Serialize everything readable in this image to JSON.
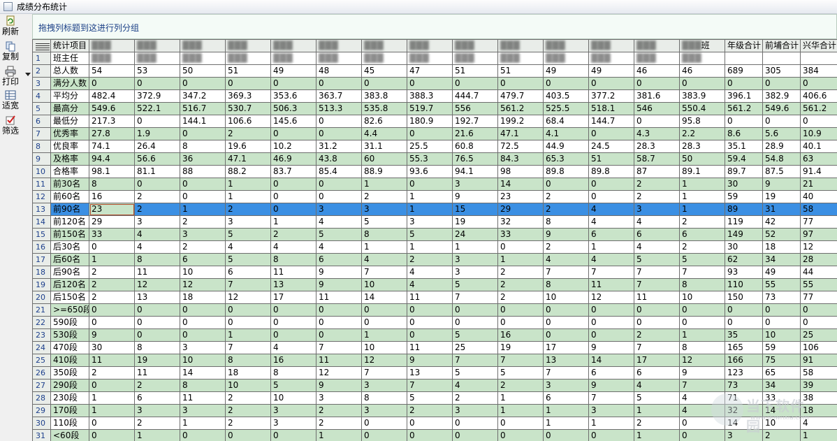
{
  "window": {
    "title": "成绩分布统计"
  },
  "toolbar": {
    "refresh": "刷新",
    "copy": "复制",
    "print": "打印",
    "fit_width": "适宽",
    "filter": "筛选"
  },
  "group_panel": {
    "hint": "拖拽列标题到这进行列分组"
  },
  "grid": {
    "header_item": "统计项目",
    "header_partial": "班",
    "header_totals": [
      "年级合计",
      "前埔合计",
      "兴华合计"
    ],
    "row1": {
      "label": "班主任",
      "placeholder": "▓▓▓"
    },
    "rows": [
      {
        "n": "2",
        "label": "总人数",
        "vals": [
          "54",
          "53",
          "50",
          "51",
          "49",
          "48",
          "45",
          "47",
          "51",
          "51",
          "49",
          "49",
          "46",
          "46",
          "689",
          "305",
          "384"
        ]
      },
      {
        "n": "3",
        "label": "满分人数",
        "vals": [
          "0",
          "0",
          "0",
          "0",
          "0",
          "0",
          "0",
          "0",
          "0",
          "0",
          "0",
          "0",
          "0",
          "0",
          "0",
          "0",
          "0"
        ]
      },
      {
        "n": "4",
        "label": "平均分",
        "vals": [
          "482.4",
          "372.9",
          "347.2",
          "369.3",
          "353.6",
          "363.7",
          "383.8",
          "388.3",
          "444.7",
          "479.7",
          "403.5",
          "377.2",
          "381.6",
          "383.9",
          "396.1",
          "382.9",
          "406.6"
        ]
      },
      {
        "n": "5",
        "label": "最高分",
        "vals": [
          "549.6",
          "522.1",
          "516.7",
          "530.7",
          "506.3",
          "513.3",
          "535.8",
          "519.7",
          "556",
          "561.2",
          "525.5",
          "518.1",
          "546",
          "550.4",
          "561.2",
          "549.6",
          "561.2"
        ]
      },
      {
        "n": "6",
        "label": "最低分",
        "vals": [
          "217.3",
          "0",
          "144.1",
          "106.6",
          "145.6",
          "0",
          "82.6",
          "180.9",
          "192.7",
          "199.2",
          "68.4",
          "144.7",
          "0",
          "95.8",
          "0",
          "0",
          "0"
        ]
      },
      {
        "n": "7",
        "label": "优秀率",
        "vals": [
          "27.8",
          "1.9",
          "0",
          "2",
          "0",
          "0",
          "4.4",
          "0",
          "21.6",
          "47.1",
          "4.1",
          "0",
          "4.3",
          "2.2",
          "8.6",
          "5.6",
          "10.9"
        ]
      },
      {
        "n": "8",
        "label": "优良率",
        "vals": [
          "74.1",
          "26.4",
          "8",
          "19.6",
          "10.2",
          "31.2",
          "31.1",
          "25.5",
          "60.8",
          "72.5",
          "44.9",
          "24.5",
          "28.3",
          "28.3",
          "35.1",
          "28.9",
          "40.1"
        ]
      },
      {
        "n": "9",
        "label": "及格率",
        "vals": [
          "94.4",
          "56.6",
          "36",
          "47.1",
          "46.9",
          "43.8",
          "60",
          "55.3",
          "76.5",
          "84.3",
          "65.3",
          "51",
          "58.7",
          "50",
          "59.4",
          "54.8",
          "63"
        ]
      },
      {
        "n": "10",
        "label": "合格率",
        "vals": [
          "98.1",
          "81.1",
          "88",
          "88.2",
          "83.7",
          "85.4",
          "88.9",
          "93.6",
          "94.1",
          "98",
          "89.8",
          "89.8",
          "87",
          "89.1",
          "89.7",
          "87.5",
          "91.4"
        ]
      },
      {
        "n": "11",
        "label": "前30名",
        "vals": [
          "8",
          "0",
          "0",
          "1",
          "0",
          "0",
          "1",
          "0",
          "3",
          "14",
          "0",
          "0",
          "2",
          "1",
          "30",
          "9",
          "21"
        ]
      },
      {
        "n": "12",
        "label": "前60名",
        "vals": [
          "16",
          "2",
          "0",
          "1",
          "0",
          "0",
          "2",
          "1",
          "9",
          "23",
          "2",
          "0",
          "2",
          "1",
          "59",
          "19",
          "40"
        ]
      },
      {
        "n": "13",
        "label": "前90名",
        "vals": [
          "23",
          "2",
          "1",
          "2",
          "0",
          "3",
          "3",
          "1",
          "15",
          "29",
          "2",
          "4",
          "3",
          "1",
          "89",
          "31",
          "58"
        ]
      },
      {
        "n": "14",
        "label": "前120名",
        "vals": [
          "29",
          "3",
          "2",
          "3",
          "1",
          "4",
          "5",
          "3",
          "19",
          "32",
          "8",
          "4",
          "4",
          "2",
          "119",
          "42",
          "77"
        ]
      },
      {
        "n": "15",
        "label": "前150名",
        "vals": [
          "33",
          "4",
          "3",
          "5",
          "2",
          "5",
          "8",
          "5",
          "24",
          "33",
          "9",
          "6",
          "6",
          "6",
          "149",
          "52",
          "97"
        ]
      },
      {
        "n": "16",
        "label": "后30名",
        "vals": [
          "0",
          "4",
          "2",
          "4",
          "4",
          "4",
          "1",
          "1",
          "1",
          "0",
          "2",
          "1",
          "4",
          "2",
          "30",
          "18",
          "12"
        ]
      },
      {
        "n": "17",
        "label": "后60名",
        "vals": [
          "1",
          "8",
          "6",
          "5",
          "8",
          "6",
          "4",
          "2",
          "3",
          "1",
          "4",
          "4",
          "5",
          "5",
          "62",
          "34",
          "28"
        ]
      },
      {
        "n": "18",
        "label": "后90名",
        "vals": [
          "2",
          "11",
          "10",
          "6",
          "11",
          "9",
          "7",
          "4",
          "3",
          "2",
          "7",
          "7",
          "7",
          "7",
          "93",
          "49",
          "44"
        ]
      },
      {
        "n": "19",
        "label": "后120名",
        "vals": [
          "2",
          "12",
          "12",
          "7",
          "13",
          "9",
          "10",
          "4",
          "5",
          "2",
          "8",
          "11",
          "7",
          "8",
          "110",
          "55",
          "55"
        ]
      },
      {
        "n": "20",
        "label": "后150名",
        "vals": [
          "2",
          "13",
          "18",
          "12",
          "17",
          "11",
          "14",
          "11",
          "7",
          "2",
          "10",
          "12",
          "11",
          "10",
          "150",
          "73",
          "77"
        ]
      },
      {
        "n": "21",
        "label": ">=650段",
        "vals": [
          "0",
          "0",
          "0",
          "0",
          "0",
          "0",
          "0",
          "0",
          "0",
          "0",
          "0",
          "0",
          "0",
          "0",
          "0",
          "0",
          "0"
        ]
      },
      {
        "n": "22",
        "label": "590段",
        "vals": [
          "0",
          "0",
          "0",
          "0",
          "0",
          "0",
          "0",
          "0",
          "0",
          "0",
          "0",
          "0",
          "0",
          "0",
          "0",
          "0",
          "0"
        ]
      },
      {
        "n": "23",
        "label": "530段",
        "vals": [
          "9",
          "0",
          "0",
          "1",
          "0",
          "0",
          "1",
          "0",
          "5",
          "16",
          "0",
          "0",
          "2",
          "1",
          "35",
          "10",
          "25"
        ]
      },
      {
        "n": "24",
        "label": "470段",
        "vals": [
          "30",
          "8",
          "3",
          "7",
          "4",
          "7",
          "10",
          "11",
          "25",
          "19",
          "17",
          "9",
          "7",
          "8",
          "165",
          "59",
          "106"
        ]
      },
      {
        "n": "25",
        "label": "410段",
        "vals": [
          "11",
          "19",
          "10",
          "8",
          "16",
          "11",
          "12",
          "9",
          "7",
          "7",
          "13",
          "14",
          "17",
          "12",
          "166",
          "75",
          "91"
        ]
      },
      {
        "n": "26",
        "label": "350段",
        "vals": [
          "2",
          "11",
          "14",
          "18",
          "8",
          "12",
          "7",
          "13",
          "5",
          "5",
          "7",
          "6",
          "6",
          "9",
          "123",
          "65",
          "58"
        ]
      },
      {
        "n": "27",
        "label": "290段",
        "vals": [
          "0",
          "2",
          "8",
          "10",
          "5",
          "9",
          "3",
          "7",
          "4",
          "2",
          "3",
          "9",
          "4",
          "7",
          "73",
          "34",
          "39"
        ]
      },
      {
        "n": "28",
        "label": "230段",
        "vals": [
          "1",
          "6",
          "11",
          "2",
          "10",
          "3",
          "8",
          "5",
          "2",
          "1",
          "6",
          "7",
          "5",
          "4",
          "71",
          "33",
          "38"
        ]
      },
      {
        "n": "29",
        "label": "170段",
        "vals": [
          "1",
          "3",
          "3",
          "2",
          "3",
          "2",
          "3",
          "2",
          "3",
          "1",
          "1",
          "3",
          "1",
          "4",
          "32",
          "14",
          "18"
        ]
      },
      {
        "n": "30",
        "label": "110段",
        "vals": [
          "0",
          "2",
          "1",
          "2",
          "3",
          "2",
          "0",
          "0",
          "0",
          "0",
          "1",
          "1",
          "2",
          "0",
          "14",
          "10",
          "4"
        ]
      },
      {
        "n": "31",
        "label": "<60段",
        "vals": [
          "0",
          "1",
          "0",
          "0",
          "0",
          "1",
          "0",
          "0",
          "0",
          "0",
          "0",
          "0",
          "1",
          "0",
          "3",
          "2",
          "1"
        ]
      }
    ],
    "selected_row": "13"
  },
  "watermark": {
    "text": "当下软件园",
    "url": "www.downxia.com"
  },
  "colors": {
    "row_green": "#c9e4c9",
    "selection": "#3b8fe3",
    "hint_text": "#1a3f86"
  }
}
